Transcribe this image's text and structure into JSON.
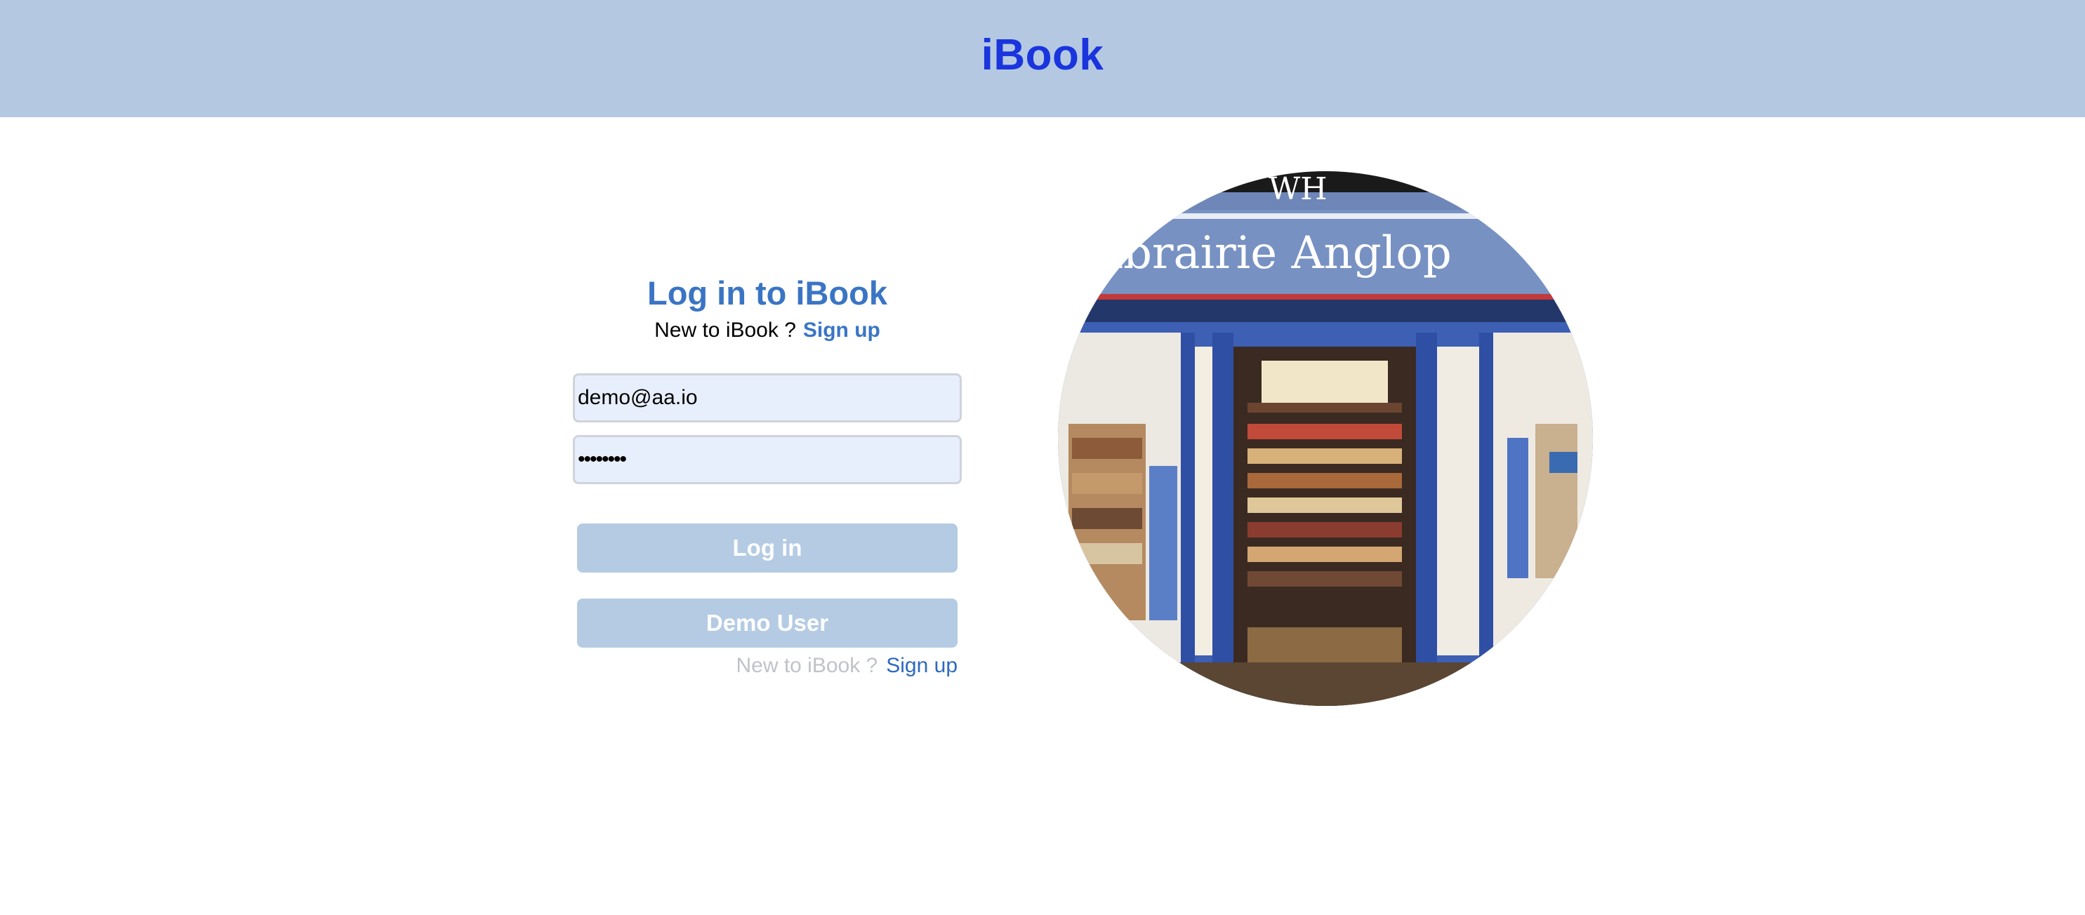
{
  "header": {
    "brand": "iBook"
  },
  "form": {
    "title": "Log in to iBook",
    "prompt": "New to iBook ?",
    "signup_link": "Sign up",
    "email_value": "demo@aa.io",
    "password_value": "password",
    "login_button": "Log in",
    "demo_button": "Demo User",
    "footer_prompt": "New to iBook ?",
    "footer_signup_link": "Sign up"
  },
  "photo": {
    "sign_text": "Librairie Anglop",
    "top_text": "WH"
  },
  "colors": {
    "header_bg": "#b4c9e1",
    "brand": "#1a35de",
    "accent": "#3a75c4",
    "button_bg": "#b4cbe3"
  }
}
